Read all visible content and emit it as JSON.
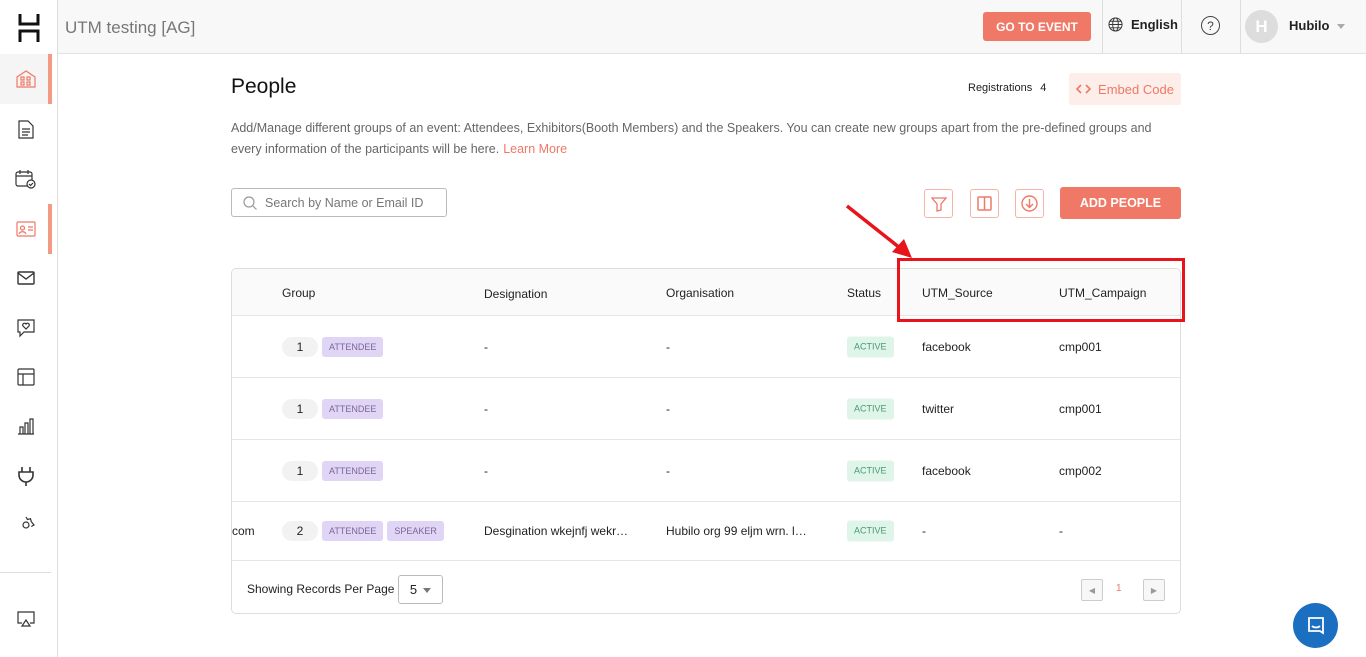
{
  "header": {
    "event_title": "UTM testing [AG]",
    "go_to_event": "GO TO EVENT",
    "language": "English",
    "help": "?",
    "avatar_initial": "H",
    "user_name": "Hubilo"
  },
  "sidebar": {
    "items": [
      "home-icon",
      "document-icon",
      "calendar-icon",
      "people-card-icon",
      "mail-icon",
      "chat-heart-icon",
      "layout-icon",
      "analytics-icon",
      "plug-icon",
      "gear-icon",
      "cast-icon"
    ],
    "active": "people-card-icon"
  },
  "page": {
    "title": "People",
    "registrations_label": "Registrations",
    "registrations_count": "4",
    "embed_code": "Embed Code",
    "description": "Add/Manage different groups of an event: Attendees, Exhibitors(Booth Members) and the Speakers. You can create new groups apart from the pre-defined groups and every information of the participants will be here.",
    "learn_more": "Learn More"
  },
  "toolbar": {
    "search_placeholder": "Search by Name or Email ID",
    "add_people": "ADD PEOPLE"
  },
  "table": {
    "columns": [
      "Group",
      "Designation",
      "Organisation",
      "Status",
      "UTM_Source",
      "UTM_Campaign"
    ],
    "rows": [
      {
        "email_fragment": "",
        "count": "1",
        "tags": [
          "ATTENDEE"
        ],
        "designation": "-",
        "organisation": "-",
        "status": "ACTIVE",
        "utm_source": "facebook",
        "utm_campaign": "cmp001"
      },
      {
        "email_fragment": "",
        "count": "1",
        "tags": [
          "ATTENDEE"
        ],
        "designation": "-",
        "organisation": "-",
        "status": "ACTIVE",
        "utm_source": "twitter",
        "utm_campaign": "cmp001"
      },
      {
        "email_fragment": "",
        "count": "1",
        "tags": [
          "ATTENDEE"
        ],
        "designation": "-",
        "organisation": "-",
        "status": "ACTIVE",
        "utm_source": "facebook",
        "utm_campaign": "cmp002"
      },
      {
        "email_fragment": "com",
        "count": "2",
        "tags": [
          "ATTENDEE",
          "SPEAKER"
        ],
        "designation": "Desgination wkejnfj wekr…",
        "organisation": "Hubilo org 99 eljm wrn. l…",
        "status": "ACTIVE",
        "utm_source": "-",
        "utm_campaign": "-"
      }
    ],
    "footer": {
      "per_page_label": "Showing Records Per Page",
      "per_page_value": "5",
      "current_page": "1"
    }
  },
  "colors": {
    "accent": "#ef7866",
    "annotation": "#e8141c",
    "chat": "#1b6fc1"
  }
}
